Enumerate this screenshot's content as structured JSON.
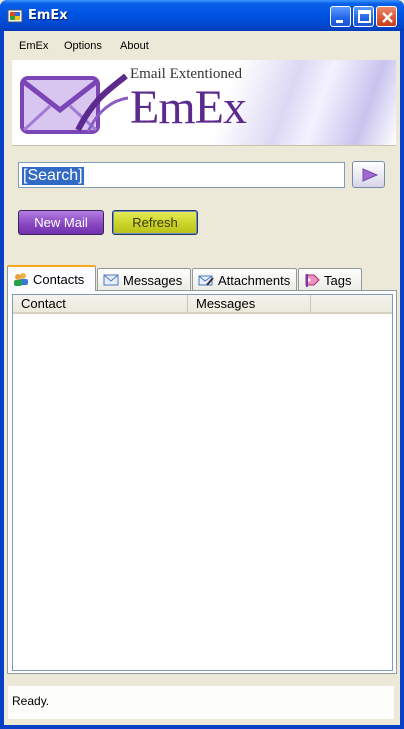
{
  "window": {
    "title": "EmEx"
  },
  "menu": [
    "EmEx",
    "Options",
    "About"
  ],
  "banner": {
    "tagline": "Email Extentioned",
    "logo_text": "EmEx"
  },
  "search": {
    "value": "[Search]"
  },
  "buttons": {
    "new_mail": "New Mail",
    "refresh": "Refresh"
  },
  "tabs": [
    {
      "label": "Contacts",
      "icon": "contacts-icon",
      "active": true
    },
    {
      "label": "Messages",
      "icon": "envelope-icon",
      "active": false
    },
    {
      "label": "Attachments",
      "icon": "attachment-icon",
      "active": false
    },
    {
      "label": "Tags",
      "icon": "tag-icon",
      "active": false
    }
  ],
  "table": {
    "columns": [
      "Contact",
      "Messages"
    ],
    "rows": []
  },
  "status": {
    "text": "Ready."
  },
  "colors": {
    "titlebar": "#0054e3",
    "new_mail": "#8a49c2",
    "refresh": "#cbd42a",
    "selection": "#316ac5"
  }
}
